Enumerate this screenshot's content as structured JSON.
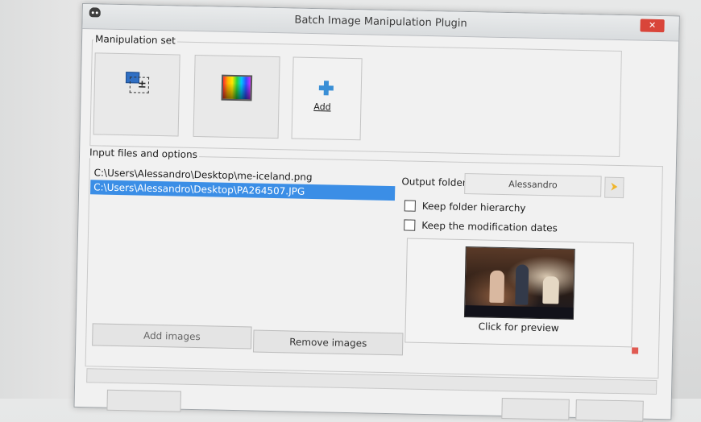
{
  "window": {
    "title": "Batch Image Manipulation Plugin",
    "close_label": "✕"
  },
  "manipulation_set": {
    "label": "Manipulation set",
    "tiles": [
      {
        "name": "resize",
        "icon": "resize-icon"
      },
      {
        "name": "color-correction",
        "icon": "color-gradient-icon"
      },
      {
        "name": "add",
        "icon": "add-icon",
        "label": "Add"
      }
    ]
  },
  "input": {
    "label": "Input files and options",
    "files": [
      {
        "path": "C:\\Users\\Alessandro\\Desktop\\me-iceland.png",
        "selected": false
      },
      {
        "path": "C:\\Users\\Alessandro\\Desktop\\PA264507.JPG",
        "selected": true
      }
    ],
    "add_images_label": "Add images",
    "remove_images_label": "Remove images"
  },
  "output": {
    "folder_label": "Output folder",
    "folder_value": "Alessandro",
    "keep_hierarchy_label": "Keep folder hierarchy",
    "keep_hierarchy_checked": false,
    "keep_dates_label": "Keep the modification dates",
    "keep_dates_checked": false
  },
  "preview": {
    "caption": "Click for preview"
  },
  "colors": {
    "selection": "#3b8ee6",
    "close": "#d9453a",
    "add_icon": "#3a8fd6"
  }
}
